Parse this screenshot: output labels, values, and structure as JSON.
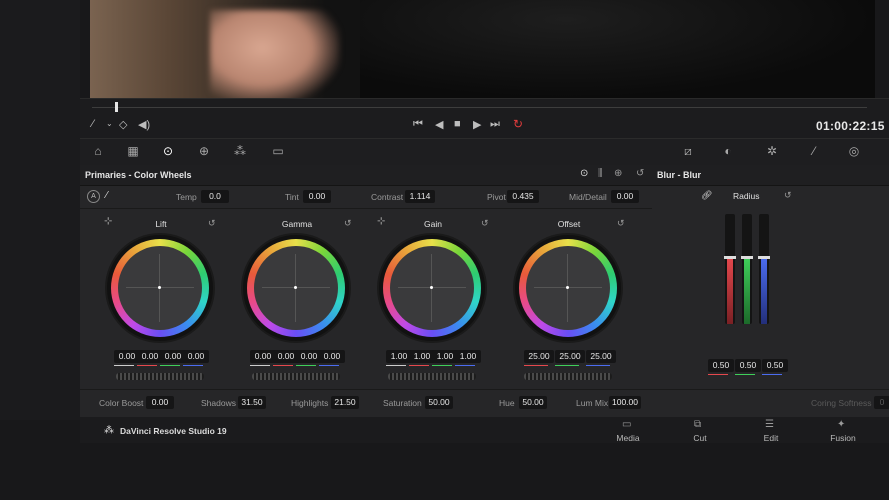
{
  "viewer": {
    "timecode": "01:00:22:15"
  },
  "primaries": {
    "title": "Primaries - Color Wheels",
    "top_params": [
      {
        "label": "Temp",
        "value": "0.0"
      },
      {
        "label": "Tint",
        "value": "0.00"
      },
      {
        "label": "Contrast",
        "value": "1.114"
      },
      {
        "label": "Pivot",
        "value": "0.435"
      },
      {
        "label": "Mid/Detail",
        "value": "0.00"
      }
    ],
    "wheels": [
      {
        "name": "Lift",
        "values": [
          "0.00",
          "0.00",
          "0.00",
          "0.00"
        ]
      },
      {
        "name": "Gamma",
        "values": [
          "0.00",
          "0.00",
          "0.00",
          "0.00"
        ]
      },
      {
        "name": "Gain",
        "values": [
          "1.00",
          "1.00",
          "1.00",
          "1.00"
        ]
      },
      {
        "name": "Offset",
        "values": [
          "25.00",
          "25.00",
          "25.00"
        ]
      }
    ],
    "bottom_params": [
      {
        "label": "Color Boost",
        "value": "0.00"
      },
      {
        "label": "Shadows",
        "value": "31.50"
      },
      {
        "label": "Highlights",
        "value": "21.50"
      },
      {
        "label": "Saturation",
        "value": "50.00"
      },
      {
        "label": "Hue",
        "value": "50.00"
      },
      {
        "label": "Lum Mix",
        "value": "100.00"
      }
    ]
  },
  "blur": {
    "title": "Blur - Blur",
    "radius_label": "Radius",
    "values": [
      "0.50",
      "0.50",
      "0.50"
    ],
    "levels": [
      0.5,
      0.5,
      0.5
    ],
    "coring_label": "Coring Softness",
    "coring_value": "0"
  },
  "app": {
    "name": "DaVinci Resolve Studio 19"
  },
  "pages": [
    {
      "label": "Media"
    },
    {
      "label": "Cut"
    },
    {
      "label": "Edit"
    },
    {
      "label": "Fusion"
    }
  ],
  "colors": {
    "red": "#e5484d",
    "green": "#3fcf5a",
    "blue": "#4b6cf0",
    "accent_red": "#e33c3c"
  }
}
